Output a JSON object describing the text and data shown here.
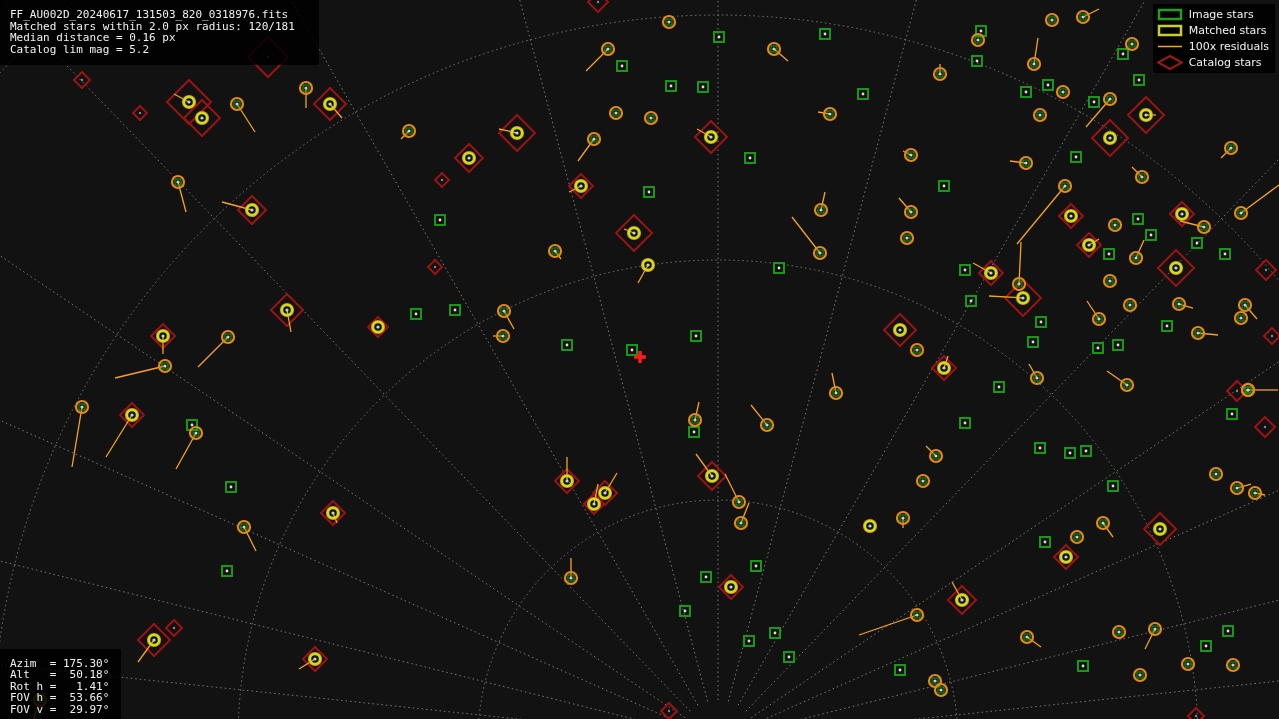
{
  "info_lines": [
    "FF_AU002D_20240617_131503_820_0318976.fits",
    "Matched stars within 2.0 px radius: 120/181",
    "Median distance = 0.16 px",
    "Catalog lim mag = 5.2"
  ],
  "legend": [
    {
      "kind": "image",
      "label": "Image stars"
    },
    {
      "kind": "matched",
      "label": "Matched stars"
    },
    {
      "kind": "residual",
      "label": "100x residuals"
    },
    {
      "kind": "catalog",
      "label": "Catalog stars"
    }
  ],
  "pointing_lines": [
    "Azim  = 175.30°",
    "Alt   =  50.18°",
    "Rot h =   1.41°",
    "FOV h =  53.66°",
    "FOV v =  29.97°"
  ]
}
